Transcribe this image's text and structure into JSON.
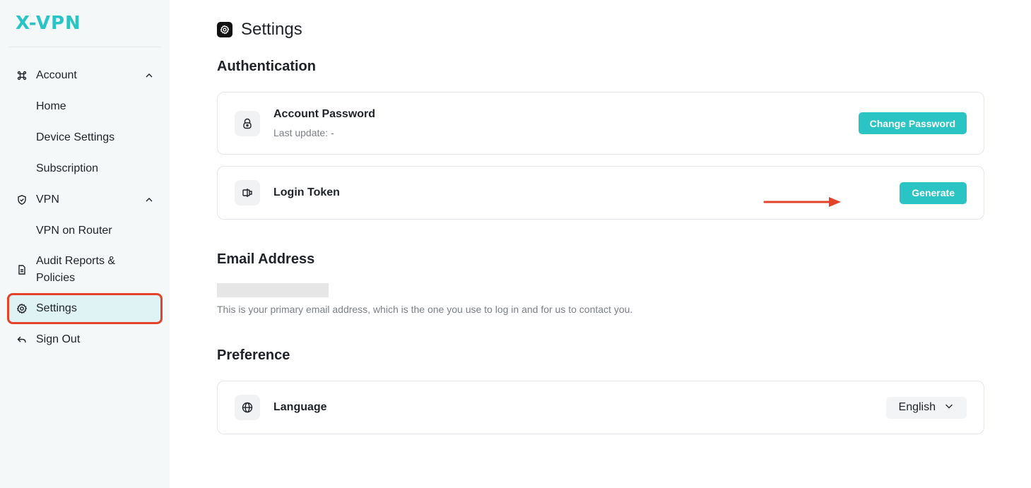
{
  "brand": {
    "logo_text": "X-VPN",
    "accent": "#2bc4c4"
  },
  "sidebar": {
    "items": [
      {
        "label": "Account",
        "icon": "command-icon",
        "expanded": true
      },
      {
        "label": "Home"
      },
      {
        "label": "Device Settings"
      },
      {
        "label": "Subscription"
      },
      {
        "label": "VPN",
        "icon": "shield-icon",
        "expanded": true
      },
      {
        "label": "VPN on Router"
      },
      {
        "label": "Audit Reports & Policies",
        "icon": "document-icon"
      },
      {
        "label": "Settings",
        "icon": "gear-icon",
        "active": true
      },
      {
        "label": "Sign Out",
        "icon": "sign-out-icon"
      }
    ]
  },
  "page": {
    "title": "Settings"
  },
  "authentication": {
    "title": "Authentication",
    "password": {
      "label": "Account Password",
      "sub": "Last update: -",
      "button": "Change Password"
    },
    "token": {
      "label": "Login Token",
      "button": "Generate"
    }
  },
  "email": {
    "title": "Email Address",
    "help": "This is your primary email address, which is the one you use to log in and for us to contact you."
  },
  "preference": {
    "title": "Preference",
    "language": {
      "label": "Language",
      "value": "English"
    }
  },
  "colors": {
    "highlight": "#e2432a",
    "active_bg": "#dff3f4",
    "sidebar_bg": "#f5f8f9"
  }
}
